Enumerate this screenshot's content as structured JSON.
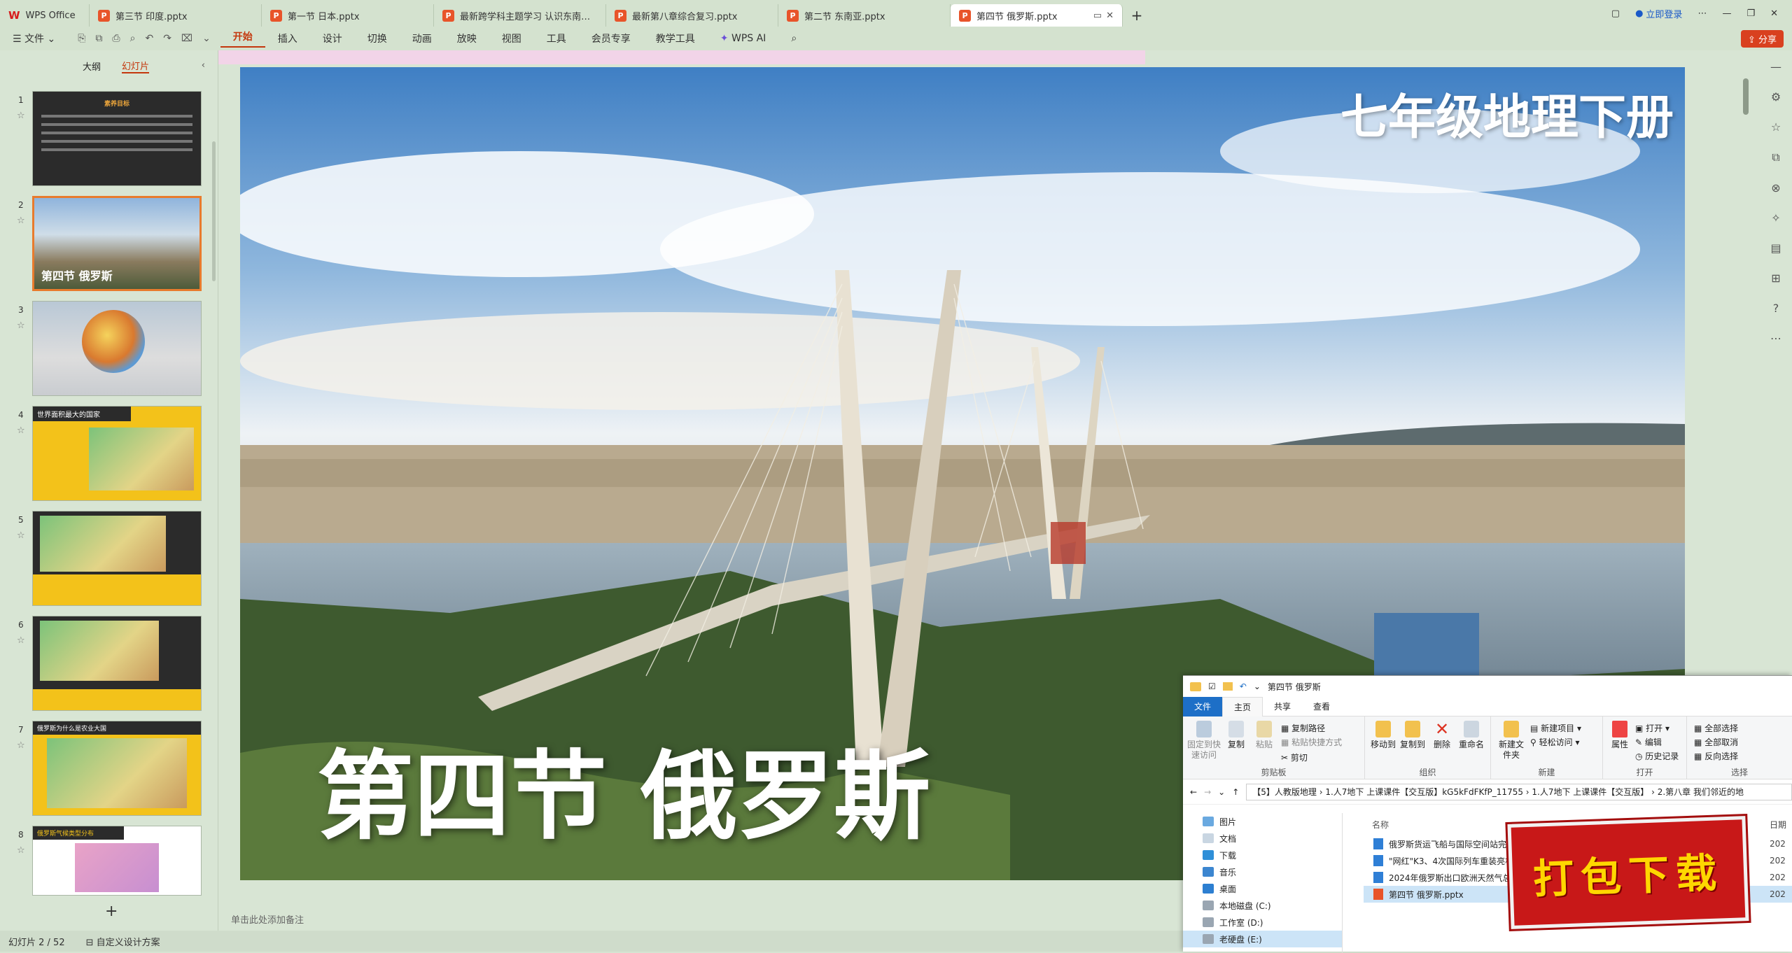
{
  "tabs": {
    "home": "WPS Office",
    "docs": [
      "第三节 印度.pptx",
      "第一节 日本.pptx",
      "最新跨学科主题学习 认识东南亚的世...",
      "最新第八章综合复习.pptx",
      "第二节 东南亚.pptx",
      "第四节 俄罗斯.pptx"
    ],
    "active_index": 5,
    "login": "立即登录"
  },
  "menu": {
    "file": "文件",
    "items": [
      "开始",
      "插入",
      "设计",
      "切换",
      "动画",
      "放映",
      "视图",
      "工具",
      "会员专享",
      "教学工具"
    ],
    "ai": "WPS AI",
    "share": "分享"
  },
  "leftpanel": {
    "outline_tab": "大纲",
    "slides_tab": "幻灯片",
    "add": "+",
    "thumbs": [
      {
        "num": "1",
        "title": "素养目标"
      },
      {
        "num": "2",
        "title": "第四节 俄罗斯"
      },
      {
        "num": "3",
        "title": ""
      },
      {
        "num": "4",
        "title": "世界面积最大的国家"
      },
      {
        "num": "5",
        "title": ""
      },
      {
        "num": "6",
        "title": ""
      },
      {
        "num": "7",
        "title": "俄罗斯为什么是农业大国"
      },
      {
        "num": "8",
        "title": "俄罗斯气候类型分布"
      }
    ],
    "selected": 1
  },
  "slide": {
    "banner": "七年级地理下册",
    "title": "第四节 俄罗斯"
  },
  "notes_placeholder": "单击此处添加备注",
  "status": {
    "slide_count": "幻灯片 2 / 52",
    "design": "自定义设计方案"
  },
  "explorer": {
    "title": "第四节 俄罗斯",
    "ribbon_tabs": [
      "文件",
      "主页",
      "共享",
      "查看"
    ],
    "groups": {
      "clipboard": "剪贴板",
      "organize": "组织",
      "new": "新建",
      "open": "打开",
      "select": "选择"
    },
    "items": {
      "pin": "固定到快速访问",
      "copy": "复制",
      "paste": "粘贴",
      "copy_path": "复制路径",
      "paste_shortcut": "粘贴快捷方式",
      "cut": "剪切",
      "move_to": "移动到",
      "copy_to": "复制到",
      "delete": "删除",
      "rename": "重命名",
      "new_folder": "新建文件夹",
      "new_item": "新建项目",
      "easy_access": "轻松访问",
      "properties": "属性",
      "open": "打开",
      "edit": "编辑",
      "history": "历史记录",
      "select_all": "全部选择",
      "select_none": "全部取消",
      "invert": "反向选择"
    },
    "path": "【5】人教版地理  ›  1.人7地下 上课课件【交互版】kG5kFdFKfP_11755  ›  1.人7地下 上课课件【交互版】  ›  2.第八章 我们邻近的地",
    "nav": [
      "图片",
      "文档",
      "下载",
      "音乐",
      "桌面",
      "本地磁盘 (C:)",
      "工作室 (D:)",
      "老硬盘 (E:)"
    ],
    "nav_selected": 7,
    "col_name": "名称",
    "col_date": "日期",
    "files": [
      {
        "name": "俄罗斯货运飞船与国际空间站完成对接",
        "date": "202"
      },
      {
        "name": "\"网红\"K3、4次国际列车重装亮相...",
        "date": "202"
      },
      {
        "name": "2024年俄罗斯出口欧洲天然气总量...",
        "date": "202"
      },
      {
        "name": "第四节 俄罗斯.pptx",
        "date": "202"
      }
    ],
    "file_selected": 3
  },
  "download_badge": "打包下载"
}
